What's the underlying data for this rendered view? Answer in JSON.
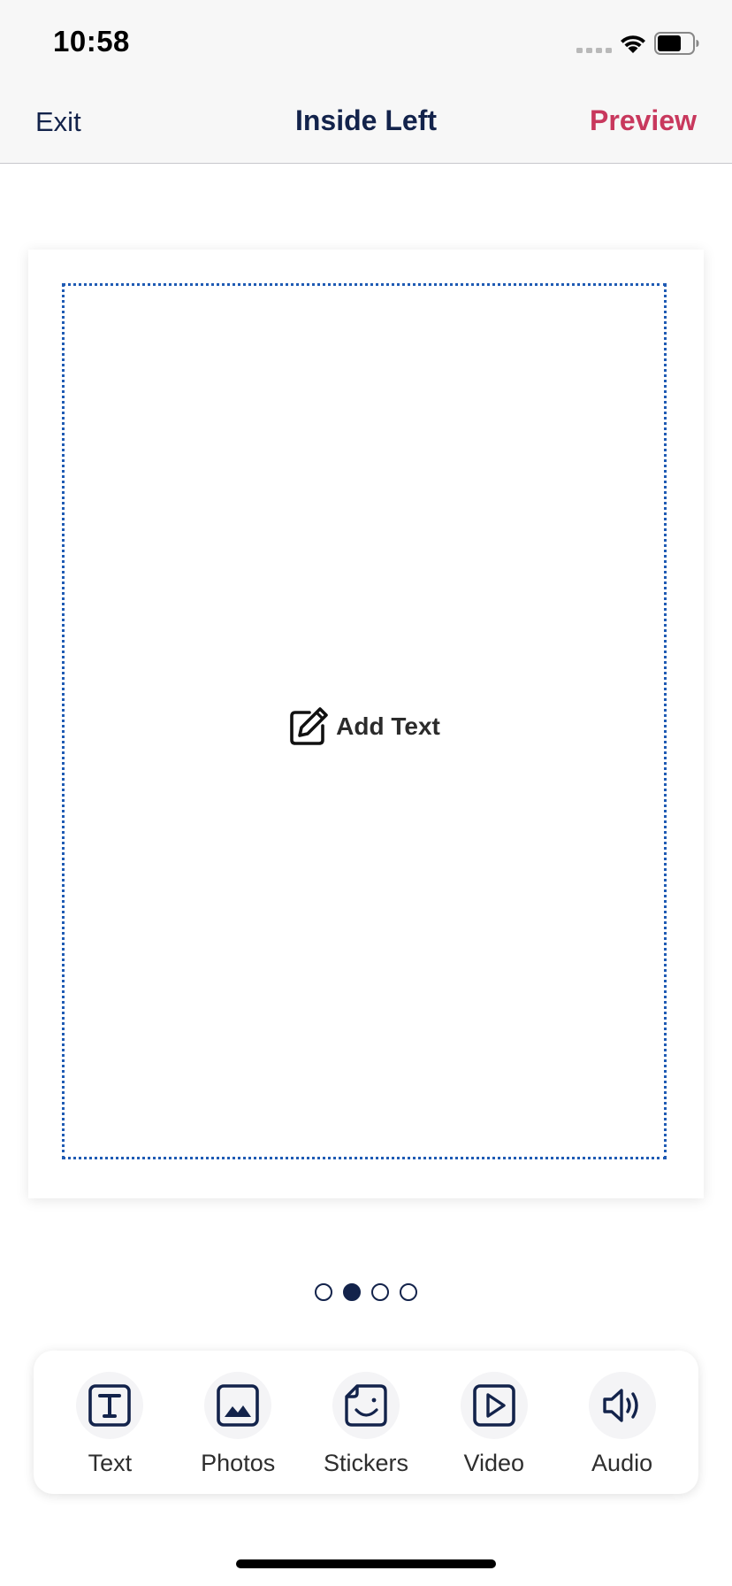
{
  "status_bar": {
    "time": "10:58",
    "icons": [
      "signal-dots-icon",
      "wifi-icon",
      "battery-icon"
    ]
  },
  "nav": {
    "exit_label": "Exit",
    "title": "Inside Left",
    "preview_label": "Preview"
  },
  "card": {
    "add_text_label": "Add Text",
    "add_text_icon": "edit-pencil-icon"
  },
  "pagination": {
    "total": 4,
    "active_index": 1
  },
  "toolbar": {
    "items": [
      {
        "label": "Text",
        "icon": "text-icon"
      },
      {
        "label": "Photos",
        "icon": "photo-icon"
      },
      {
        "label": "Stickers",
        "icon": "sticker-icon"
      },
      {
        "label": "Video",
        "icon": "video-play-icon"
      },
      {
        "label": "Audio",
        "icon": "speaker-icon"
      }
    ]
  },
  "colors": {
    "navy": "#13234b",
    "preview_accent": "#c8385d",
    "dotted_border": "#1f5bb4",
    "bar_background": "#f7f7f7"
  }
}
